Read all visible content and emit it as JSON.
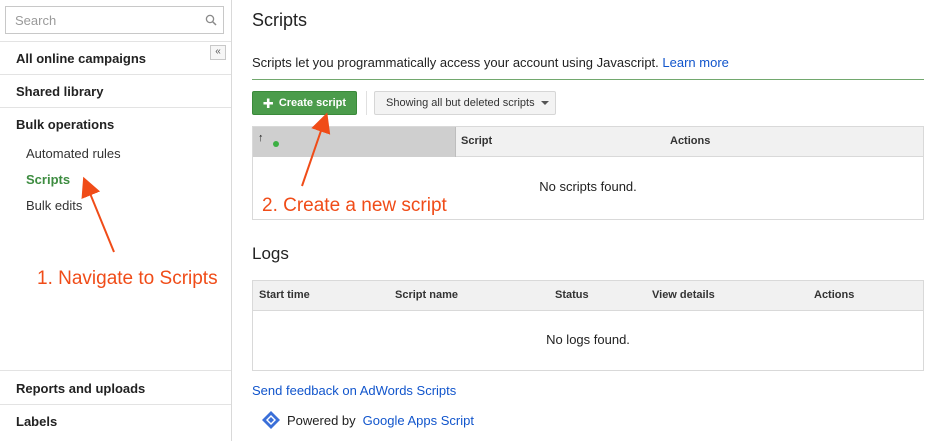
{
  "sidebar": {
    "search_placeholder": "Search",
    "collapse_label": "«",
    "items": [
      {
        "label": "All online campaigns"
      },
      {
        "label": "Shared library"
      },
      {
        "label": "Bulk operations"
      }
    ],
    "sub_items": [
      {
        "label": "Automated rules",
        "active": false
      },
      {
        "label": "Scripts",
        "active": true
      },
      {
        "label": "Bulk edits",
        "active": false
      }
    ],
    "bottom_items": [
      {
        "label": "Reports and uploads"
      },
      {
        "label": "Labels"
      }
    ]
  },
  "main": {
    "title": "Scripts",
    "description": "Scripts let you programmatically access your account using Javascript.",
    "learn_more": "Learn more",
    "create_button": "Create script",
    "filter_button": "Showing all but deleted scripts",
    "scripts_table": {
      "sort_arrow": "↑",
      "columns": [
        "Script",
        "Actions"
      ],
      "empty_message": "No scripts found."
    },
    "logs_title": "Logs",
    "logs_table": {
      "columns": [
        "Start time",
        "Script name",
        "Status",
        "View details",
        "Actions"
      ],
      "empty_message": "No logs found."
    },
    "feedback_link": "Send feedback on AdWords Scripts",
    "powered_by_text": "Powered by",
    "powered_by_link": "Google Apps Script"
  },
  "annotations": {
    "step1": "1. Navigate to Scripts",
    "step2": "2. Create a new script"
  },
  "colors": {
    "accent_green": "#4b9c4b",
    "link_blue": "#1155cc",
    "annotation_orange": "#f04c18"
  }
}
